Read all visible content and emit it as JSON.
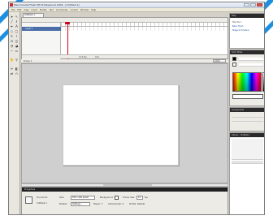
{
  "window": {
    "title": "Macromedia Flash MX Professional 2004 - [Untitled-1]"
  },
  "menubar": {
    "items": [
      "File",
      "Edit",
      "View",
      "Insert",
      "Modify",
      "Text",
      "Commands",
      "Control",
      "Window",
      "Help"
    ]
  },
  "document": {
    "tab_label": "Untitled-1"
  },
  "timeline": {
    "layer_name": "Layer 1",
    "footer_fps": "12.0 fps",
    "footer_time": "0.0s"
  },
  "stage_bar": {
    "scene": "Scene 1",
    "zoom": "100%"
  },
  "properties": {
    "header": "Properties",
    "doc_label": "Document",
    "doc_name": "Untitled-1",
    "size_label": "Size:",
    "size_value": "550 x 400 pixels",
    "background_label": "Background:",
    "framerate_label": "Frame rate:",
    "framerate_value": "12",
    "fps_label": "fps",
    "publish_label": "Publish:",
    "settings_value": "Settings...",
    "player_label": "Player: 7",
    "actionscript_label": "ActionScript: 2",
    "profile_label": "Profile: Default"
  },
  "panels": {
    "help_title": "Help",
    "help_lines": [
      "How Do I",
      "Basic Flash",
      "Stage & Timeline"
    ],
    "color_title": "Color Mixer",
    "components_title": "Components",
    "library_title": "Library - Untitled-1"
  },
  "colors": {
    "accent_stripe": "#1d8fe0",
    "layer_selected": "#4b6ea9",
    "playhead": "#d0021b",
    "stage_bg": "#ffffff",
    "pasteboard": "#cfcfcf"
  }
}
